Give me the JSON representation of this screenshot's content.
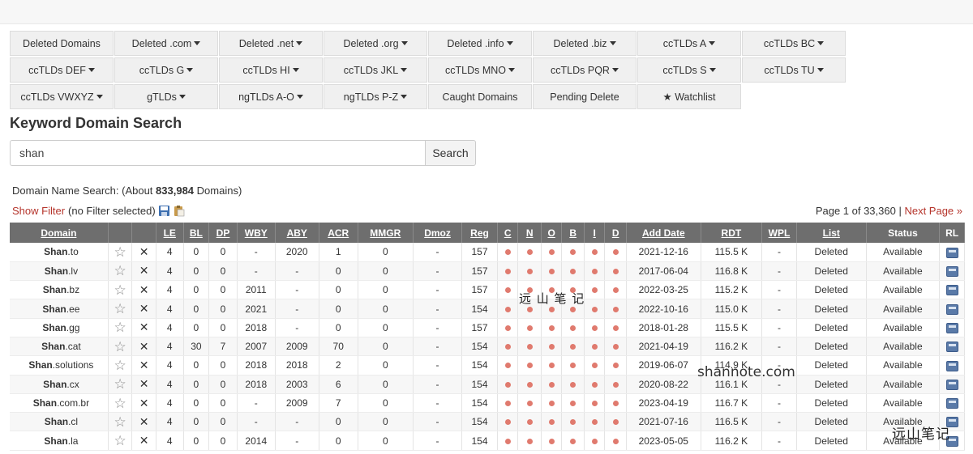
{
  "nav": [
    {
      "label": "Deleted Domains",
      "dd": false
    },
    {
      "label": "Deleted .com",
      "dd": true
    },
    {
      "label": "Deleted .net",
      "dd": true
    },
    {
      "label": "Deleted .org",
      "dd": true
    },
    {
      "label": "Deleted .info",
      "dd": true
    },
    {
      "label": "Deleted .biz",
      "dd": true
    },
    {
      "label": "ccTLDs A",
      "dd": true
    },
    {
      "label": "ccTLDs BC",
      "dd": true
    },
    {
      "label": "ccTLDs DEF",
      "dd": true
    },
    {
      "label": "ccTLDs G",
      "dd": true
    },
    {
      "label": "ccTLDs HI",
      "dd": true
    },
    {
      "label": "ccTLDs JKL",
      "dd": true
    },
    {
      "label": "ccTLDs MNO",
      "dd": true
    },
    {
      "label": "ccTLDs PQR",
      "dd": true
    },
    {
      "label": "ccTLDs S",
      "dd": true
    },
    {
      "label": "ccTLDs TU",
      "dd": true
    },
    {
      "label": "ccTLDs VWXYZ",
      "dd": true
    },
    {
      "label": "gTLDs",
      "dd": true
    },
    {
      "label": "ngTLDs A-O",
      "dd": true
    },
    {
      "label": "ngTLDs P-Z",
      "dd": true
    },
    {
      "label": "Caught Domains",
      "dd": false
    },
    {
      "label": "Pending Delete",
      "dd": false
    },
    {
      "label": "★ Watchlist",
      "dd": false
    }
  ],
  "page_title": "Keyword Domain Search",
  "search": {
    "value": "shan",
    "button": "Search"
  },
  "summary": {
    "prefix": "Domain Name Search: (About ",
    "count": "833,984",
    "suffix": " Domains)"
  },
  "filter": {
    "link": "Show Filter",
    "status": "(no Filter selected)"
  },
  "pager": {
    "text": "Page 1 of 33,360 | ",
    "next": "Next Page »"
  },
  "columns": [
    "Domain",
    "",
    "",
    "LE",
    "BL",
    "DP",
    "WBY",
    "ABY",
    "ACR",
    "MMGR",
    "Dmoz",
    "Reg",
    "C",
    "N",
    "O",
    "B",
    "I",
    "D",
    "Add Date",
    "RDT",
    "WPL",
    "List",
    "Status",
    "RL"
  ],
  "rows": [
    {
      "kw": "Shan",
      "tld": ".to",
      "le": "4",
      "bl": "0",
      "dp": "0",
      "wby": "-",
      "aby": "2020",
      "acr": "1",
      "mmgr": "0",
      "dmoz": "-",
      "reg": "157",
      "date": "2021-12-16",
      "rdt": "115.5 K",
      "wpl": "-",
      "list": "Deleted",
      "status": "Available"
    },
    {
      "kw": "Shan",
      "tld": ".lv",
      "le": "4",
      "bl": "0",
      "dp": "0",
      "wby": "-",
      "aby": "-",
      "acr": "0",
      "mmgr": "0",
      "dmoz": "-",
      "reg": "157",
      "date": "2017-06-04",
      "rdt": "116.8 K",
      "wpl": "-",
      "list": "Deleted",
      "status": "Available"
    },
    {
      "kw": "Shan",
      "tld": ".bz",
      "le": "4",
      "bl": "0",
      "dp": "0",
      "wby": "2011",
      "aby": "-",
      "acr": "0",
      "mmgr": "0",
      "dmoz": "-",
      "reg": "157",
      "date": "2022-03-25",
      "rdt": "115.2 K",
      "wpl": "-",
      "list": "Deleted",
      "status": "Available"
    },
    {
      "kw": "Shan",
      "tld": ".ee",
      "le": "4",
      "bl": "0",
      "dp": "0",
      "wby": "2021",
      "aby": "-",
      "acr": "0",
      "mmgr": "0",
      "dmoz": "-",
      "reg": "154",
      "date": "2022-10-16",
      "rdt": "115.0 K",
      "wpl": "-",
      "list": "Deleted",
      "status": "Available"
    },
    {
      "kw": "Shan",
      "tld": ".gg",
      "le": "4",
      "bl": "0",
      "dp": "0",
      "wby": "2018",
      "aby": "-",
      "acr": "0",
      "mmgr": "0",
      "dmoz": "-",
      "reg": "157",
      "date": "2018-01-28",
      "rdt": "115.5 K",
      "wpl": "-",
      "list": "Deleted",
      "status": "Available"
    },
    {
      "kw": "Shan",
      "tld": ".cat",
      "le": "4",
      "bl": "30",
      "dp": "7",
      "wby": "2007",
      "aby": "2009",
      "acr": "70",
      "mmgr": "0",
      "dmoz": "-",
      "reg": "154",
      "date": "2021-04-19",
      "rdt": "116.2 K",
      "wpl": "-",
      "list": "Deleted",
      "status": "Available"
    },
    {
      "kw": "Shan",
      "tld": ".solutions",
      "le": "4",
      "bl": "0",
      "dp": "0",
      "wby": "2018",
      "aby": "2018",
      "acr": "2",
      "mmgr": "0",
      "dmoz": "-",
      "reg": "154",
      "date": "2019-06-07",
      "rdt": "114.9 K",
      "wpl": "-",
      "list": "Deleted",
      "status": "Available"
    },
    {
      "kw": "Shan",
      "tld": ".cx",
      "le": "4",
      "bl": "0",
      "dp": "0",
      "wby": "2018",
      "aby": "2003",
      "acr": "6",
      "mmgr": "0",
      "dmoz": "-",
      "reg": "154",
      "date": "2020-08-22",
      "rdt": "116.1 K",
      "wpl": "-",
      "list": "Deleted",
      "status": "Available"
    },
    {
      "kw": "Shan",
      "tld": ".com.br",
      "le": "4",
      "bl": "0",
      "dp": "0",
      "wby": "-",
      "aby": "2009",
      "acr": "7",
      "mmgr": "0",
      "dmoz": "-",
      "reg": "154",
      "date": "2023-04-19",
      "rdt": "116.7 K",
      "wpl": "-",
      "list": "Deleted",
      "status": "Available"
    },
    {
      "kw": "Shan",
      "tld": ".cl",
      "le": "4",
      "bl": "0",
      "dp": "0",
      "wby": "-",
      "aby": "-",
      "acr": "0",
      "mmgr": "0",
      "dmoz": "-",
      "reg": "154",
      "date": "2021-07-16",
      "rdt": "116.5 K",
      "wpl": "-",
      "list": "Deleted",
      "status": "Available"
    },
    {
      "kw": "Shan",
      "tld": ".la",
      "le": "4",
      "bl": "0",
      "dp": "0",
      "wby": "2014",
      "aby": "-",
      "acr": "0",
      "mmgr": "0",
      "dmoz": "-",
      "reg": "154",
      "date": "2023-05-05",
      "rdt": "116.2 K",
      "wpl": "-",
      "list": "Deleted",
      "status": "Available"
    }
  ],
  "watermarks": {
    "center": "远 山 笔 记",
    "url": "shannote.com",
    "corner": "远山笔记"
  },
  "colors": {
    "link": "#b5342b",
    "available": "#2e9e2e",
    "header": "#6e6e6e",
    "dot": "#e07a6e"
  }
}
